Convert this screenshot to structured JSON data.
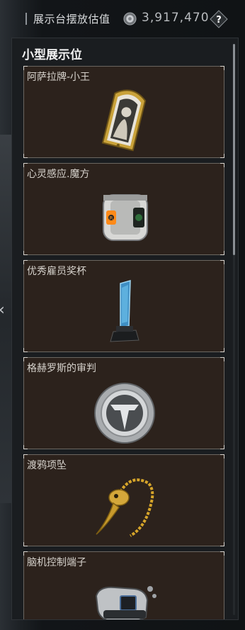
{
  "header": {
    "title": "展示台摆放估值",
    "value": "3,917,470",
    "help": "?"
  },
  "section": {
    "title": "小型展示位"
  },
  "items": [
    {
      "label": "阿萨拉牌-小王",
      "icon": "asala-card-icon"
    },
    {
      "label": "心灵感应.魔方",
      "icon": "telepathy-cube-icon"
    },
    {
      "label": "优秀雇员奖杯",
      "icon": "employee-trophy-icon"
    },
    {
      "label": "格赫罗斯的审判",
      "icon": "judgment-medallion-icon"
    },
    {
      "label": "渡鸦项坠",
      "icon": "raven-pendant-icon"
    },
    {
      "label": "脑机控制端子",
      "icon": "brain-interface-icon"
    }
  ],
  "colors": {
    "card_bg": "#2c221c",
    "card_border": "#6b6660",
    "panel_bg": "#1a1d20"
  }
}
